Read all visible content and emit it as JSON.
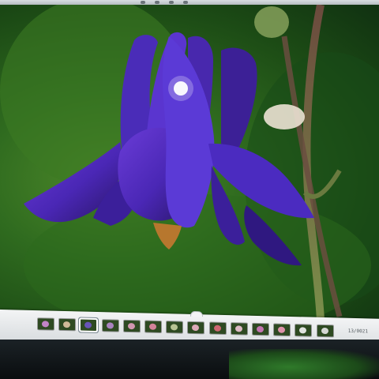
{
  "viewer": {
    "counter": "13/0021",
    "thumbnails": [
      {
        "name": "thumb-1",
        "flower": "#d38bd8",
        "selected": false
      },
      {
        "name": "thumb-2",
        "flower": "#e3c6a5",
        "selected": false
      },
      {
        "name": "thumb-3",
        "flower": "#6f55c8",
        "selected": true
      },
      {
        "name": "thumb-4",
        "flower": "#b88ad0",
        "selected": false
      },
      {
        "name": "thumb-5",
        "flower": "#e4a0c0",
        "selected": false
      },
      {
        "name": "thumb-6",
        "flower": "#e58aa6",
        "selected": false
      },
      {
        "name": "thumb-7",
        "flower": "#c8d0a0",
        "selected": false
      },
      {
        "name": "thumb-8",
        "flower": "#f0b4c8",
        "selected": false
      },
      {
        "name": "thumb-9",
        "flower": "#e06a7a",
        "selected": false
      },
      {
        "name": "thumb-10",
        "flower": "#f2c8d8",
        "selected": false
      },
      {
        "name": "thumb-11",
        "flower": "#d47ac0",
        "selected": false
      },
      {
        "name": "thumb-12",
        "flower": "#f19ab8",
        "selected": false
      },
      {
        "name": "thumb-13",
        "flower": "#f4f4f4",
        "selected": false
      },
      {
        "name": "thumb-14",
        "flower": "#e8e8e8",
        "selected": false
      }
    ]
  },
  "colors": {
    "accent": "#5a3fc0",
    "background": "#2f6b1f"
  }
}
